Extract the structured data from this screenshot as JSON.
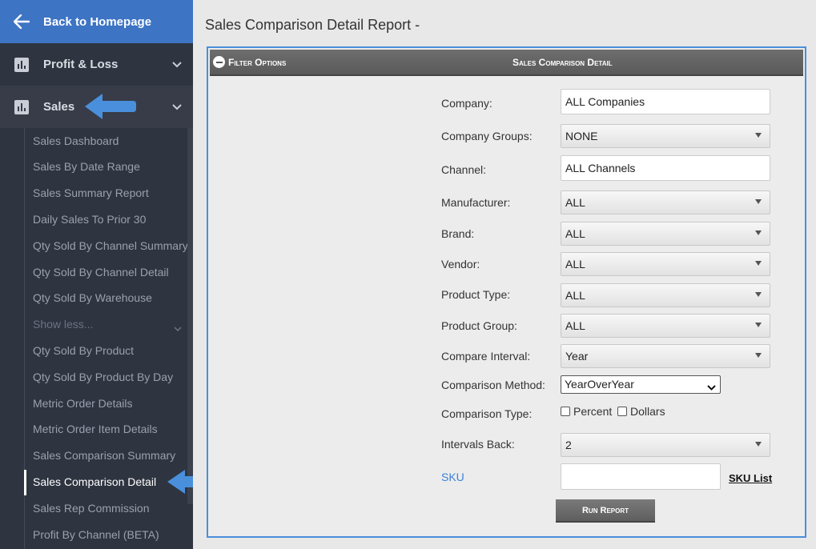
{
  "sidebar": {
    "back_label": "Back to Homepage",
    "sections": [
      {
        "label": "Profit & Loss",
        "icon": "bar-chart-icon"
      },
      {
        "label": "Sales",
        "icon": "bar-chart-icon"
      }
    ],
    "items": [
      "Sales Dashboard",
      "Sales By Date Range",
      "Sales Summary Report",
      "Daily Sales To Prior 30",
      "Qty Sold By Channel Summary",
      "Qty Sold By Channel Detail",
      "Qty Sold By Warehouse",
      "Show less...",
      "Qty Sold By Product",
      "Qty Sold By Product By Day",
      "Metric Order Details",
      "Metric Order Item Details",
      "Sales Comparison Summary",
      "Sales Comparison Detail",
      "Sales Rep Commission",
      "Profit By Channel (BETA)"
    ],
    "current_item": "Sales Comparison Detail"
  },
  "page": {
    "title": "Sales Comparison Detail Report -"
  },
  "panel": {
    "filter_label": "Filter Options",
    "title": "Sales Comparison Detail"
  },
  "form": {
    "company": {
      "label": "Company:",
      "value": "ALL Companies"
    },
    "company_groups": {
      "label": "Company Groups:",
      "value": "NONE"
    },
    "channel": {
      "label": "Channel:",
      "value": "ALL Channels"
    },
    "manufacturer": {
      "label": "Manufacturer:",
      "value": "ALL"
    },
    "brand": {
      "label": "Brand:",
      "value": "ALL"
    },
    "vendor": {
      "label": "Vendor:",
      "value": "ALL"
    },
    "product_type": {
      "label": "Product Type:",
      "value": "ALL"
    },
    "product_group": {
      "label": "Product Group:",
      "value": "ALL"
    },
    "compare_interval": {
      "label": "Compare Interval:",
      "value": "Year"
    },
    "comparison_method": {
      "label": "Comparison Method:",
      "value": "YearOverYear"
    },
    "comparison_type": {
      "label": "Comparison Type:",
      "option_percent": "Percent",
      "option_dollars": "Dollars",
      "percent_checked": false,
      "dollars_checked": false
    },
    "intervals_back": {
      "label": "Intervals Back:",
      "value": "2"
    },
    "sku": {
      "label": "SKU",
      "value": "",
      "list_link": "SKU List"
    },
    "run_button": "Run Report"
  },
  "colors": {
    "sidebar_bg": "#2e3440",
    "back_bar_bg": "#3d74c4",
    "panel_border": "#4a8fdb",
    "pointer_arrow": "#4a8fdb"
  }
}
